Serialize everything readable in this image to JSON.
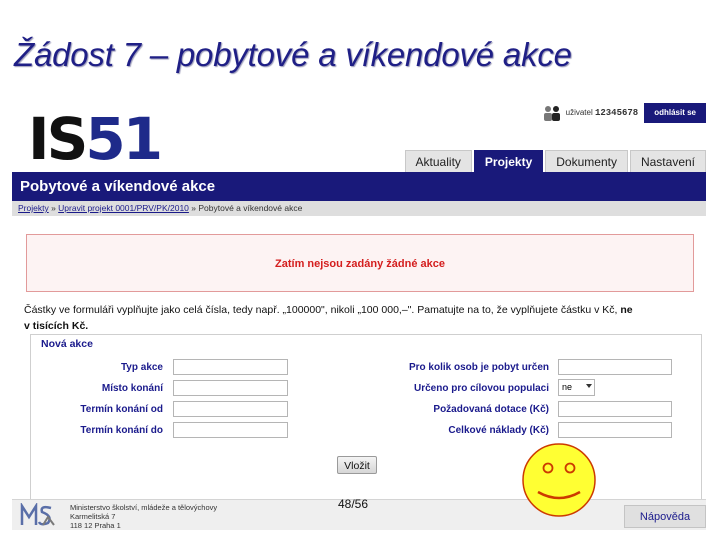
{
  "slide": {
    "title": "Žádost 7 – pobytové a víkendové akce",
    "page_number": "48/56"
  },
  "app": {
    "logo_is": "IS",
    "logo_51": "51",
    "user_label": "uživatel",
    "user_id": "12345678",
    "logout_label": "odhlásit se",
    "tabs": [
      {
        "label": "Aktuality",
        "active": false
      },
      {
        "label": "Projekty",
        "active": true
      },
      {
        "label": "Dokumenty",
        "active": false
      },
      {
        "label": "Nastavení",
        "active": false
      }
    ],
    "page_title": "Pobytové a víkendové akce",
    "breadcrumb": {
      "item1": "Projekty",
      "sep1": " » ",
      "item2": "Upravit projekt 0001/PRV/PK/2010",
      "sep2": " » ",
      "item3": "Pobytové a víkendové akce"
    },
    "alert_text": "Zatím nejsou zadány žádné akce",
    "info_text_a": "Částky ve formuláři vyplňujte jako celá čísla, tedy např. „100000\", nikoli „100 000,–\". Pamatujte na to, že vyplňujete částku v Kč,",
    "info_text_b": " ne",
    "info_text_c": "v tisících Kč.",
    "form": {
      "legend": "Nová akce",
      "left_labels": [
        "Typ akce",
        "Místo konání",
        "Termín konání od",
        "Termín konání do"
      ],
      "right_labels": [
        "Pro kolik osob je pobyt určen",
        "Určeno pro cílovou populaci",
        "Požadovaná dotace (Kč)",
        "Celkové náklady (Kč)"
      ],
      "target_population_value": "ne",
      "submit_label": "Vložit"
    },
    "footer": {
      "line1": "Ministerstvo školství, mládeže a tělovýchovy",
      "line2": "Karmelitská 7",
      "line3": "118 12 Praha 1",
      "help_label": "Nápověda"
    }
  },
  "colors": {
    "navy": "#19197a",
    "alert_red": "#d41e1e",
    "label_blue": "#1a1a8c",
    "smiley_yellow": "#ffff33"
  }
}
